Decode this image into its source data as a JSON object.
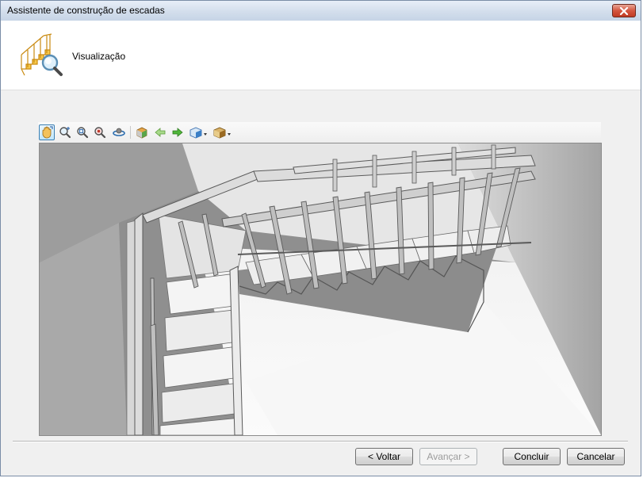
{
  "window": {
    "title": "Assistente de construção de escadas"
  },
  "header": {
    "label": "Visualização",
    "icon": "staircase-preview-icon"
  },
  "toolbar": {
    "buttons": [
      {
        "name": "pan-icon",
        "active": true
      },
      {
        "name": "zoom-in-out-icon"
      },
      {
        "name": "zoom-window-icon"
      },
      {
        "name": "zoom-extents-icon"
      },
      {
        "name": "orbit-icon"
      },
      {
        "name": "views-icon"
      },
      {
        "name": "previous-view-icon"
      },
      {
        "name": "next-view-icon"
      },
      {
        "name": "view-cube-dropdown-icon"
      },
      {
        "name": "render-mode-dropdown-icon"
      }
    ]
  },
  "viewport": {
    "content": "3d-staircase-model"
  },
  "footer": {
    "back_label": "< Voltar",
    "next_label": "Avançar >",
    "finish_label": "Concluir",
    "cancel_label": "Cancelar"
  },
  "colors": {
    "accent": "#3c7fb1",
    "close": "#c03a22",
    "header_bg": "#ffffff",
    "dialog_bg": "#f0f0f0"
  }
}
